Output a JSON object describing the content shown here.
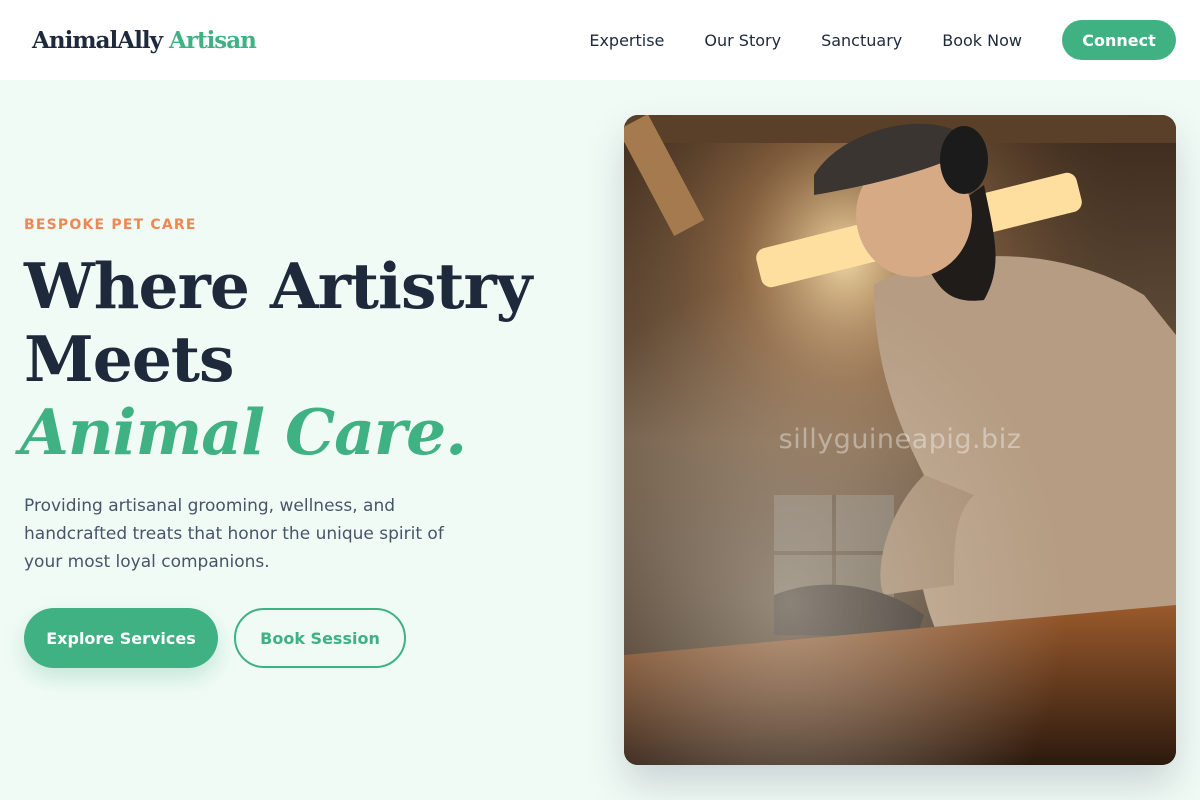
{
  "header": {
    "logo_main": "AnimalAlly",
    "logo_accent": "Artisan",
    "nav": [
      {
        "label": "Expertise"
      },
      {
        "label": "Our Story"
      },
      {
        "label": "Sanctuary"
      },
      {
        "label": "Book Now"
      }
    ],
    "cta_label": "Connect"
  },
  "hero": {
    "eyebrow": "BESPOKE PET CARE",
    "headline_line1": "Where Artistry",
    "headline_line2": "Meets",
    "headline_accent": "Animal Care.",
    "description": "Providing artisanal grooming, wellness, and handcrafted treats that honor the unique spirit of your most loyal companions.",
    "primary_button": "Explore Services",
    "secondary_button": "Book Session",
    "image_watermark": "sillyguineapig.biz"
  },
  "colors": {
    "accent": "#3fb183",
    "eyebrow": "#ee8754",
    "text_dark": "#1e293b",
    "background": "#f1fbf6"
  }
}
